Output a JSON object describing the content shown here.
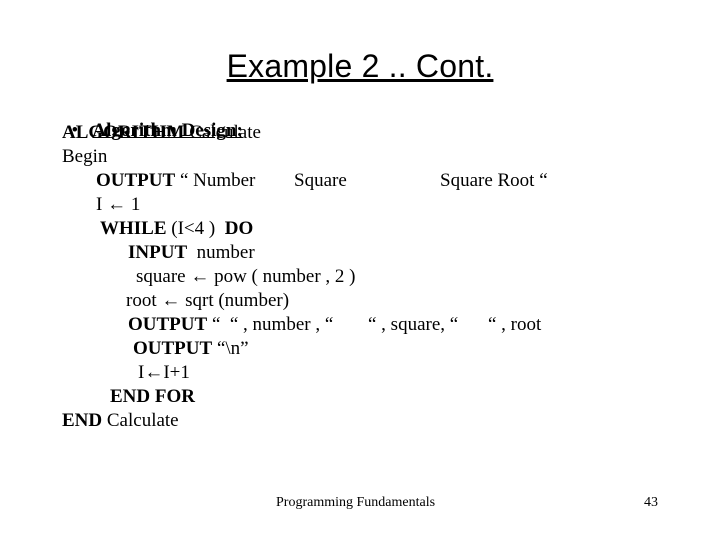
{
  "slide": {
    "title": "Example 2 .. Cont.",
    "bullet": "•",
    "heading": "Algorithm Design:",
    "lines": {
      "l1_kw": "ALGORITHM",
      "l1_rest": " Calculate",
      "l2": "Begin",
      "l3_kw": "OUTPUT",
      "l3_a": " “ Number",
      "l3_b": "Square",
      "l3_c": "Square Root “",
      "l4": "I ← 1",
      "l5_kw": "WHILE",
      "l5_rest": " (I<4 )  ",
      "l5_kw2": "DO",
      "l6_kw": "INPUT",
      "l6_rest": "  number",
      "l7": "square ← pow ( number , 2 )",
      "l8": "root ← sqrt (number)",
      "l9_kw": "OUTPUT",
      "l9_a": " “  “ , number , “",
      "l9_b": "“ , square, “",
      "l9_c": "“ , root",
      "l10_kw": "OUTPUT",
      "l10_rest": " “\\n”",
      "l11": "I←I+1",
      "l12": "END FOR",
      "l13_kw": "END",
      "l13_rest": " Calculate"
    },
    "footer_text": "Programming Fundamentals",
    "page_number": "43"
  }
}
